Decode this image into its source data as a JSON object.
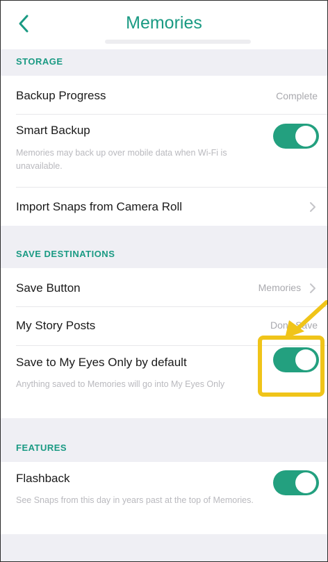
{
  "header": {
    "title": "Memories",
    "back_icon": "chevron-left-icon"
  },
  "colors": {
    "accent": "#1a9a83",
    "toggle_on": "#23a07f",
    "annotation": "#f0c419"
  },
  "sections": {
    "storage": {
      "title": "STORAGE",
      "backup_progress": {
        "label": "Backup Progress",
        "value": "Complete"
      },
      "smart_backup": {
        "label": "Smart Backup",
        "description": "Memories may back up over mobile data when Wi-Fi is unavailable.",
        "enabled": true
      },
      "import": {
        "label": "Import Snaps from Camera Roll"
      }
    },
    "save_destinations": {
      "title": "SAVE DESTINATIONS",
      "save_button": {
        "label": "Save Button",
        "value": "Memories"
      },
      "my_story_posts": {
        "label": "My Story Posts",
        "value": "Don't Save"
      },
      "my_eyes_only": {
        "label": "Save to My Eyes Only by default",
        "description": "Anything saved to Memories will go into My Eyes Only",
        "enabled": true
      }
    },
    "features": {
      "title": "FEATURES",
      "flashback": {
        "label": "Flashback",
        "description": "See Snaps from this day in years past at the top of Memories.",
        "enabled": true
      }
    }
  }
}
